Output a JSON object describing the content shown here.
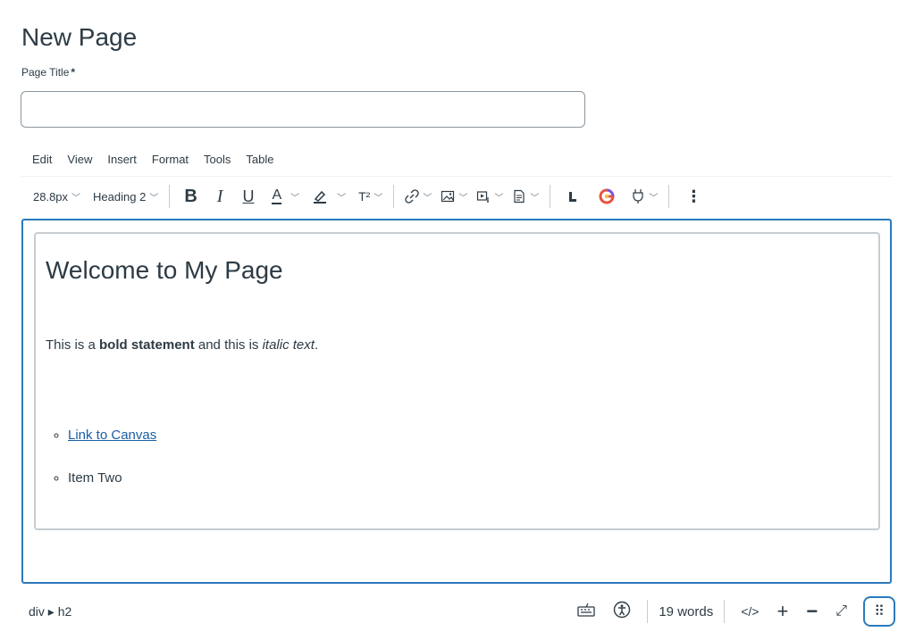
{
  "page": {
    "heading": "New Page",
    "title_label": "Page Title",
    "title_required": "*",
    "title_value": ""
  },
  "menubar": [
    "Edit",
    "View",
    "Insert",
    "Format",
    "Tools",
    "Table"
  ],
  "toolbar": {
    "font_size": "28.8px",
    "block_format": "Heading 2",
    "bold_glyph": "B",
    "italic_glyph": "I",
    "underline_glyph": "U",
    "text_color_glyph": "A",
    "superscript_glyph": "T²",
    "more_glyph": "⋮",
    "icons": [
      "bold-icon",
      "italic-icon",
      "underline-icon",
      "text-color-icon",
      "highlight-icon",
      "superscript-icon",
      "link-icon",
      "image-icon",
      "media-icon",
      "document-icon",
      "lti-icon",
      "apps-icon",
      "plugin-icon",
      "more-icon"
    ]
  },
  "content": {
    "heading": "Welcome to My Page",
    "para_pre": "This is a ",
    "para_bold": "bold statement",
    "para_mid": " and this is ",
    "para_italic": "italic text",
    "para_end": ".",
    "list": [
      "Link to Canvas",
      "Item Two"
    ]
  },
  "status": {
    "path": "div ▸ h2",
    "word_count": "19 words",
    "html_toggle": "</>",
    "zoom_in": "+",
    "zoom_out": "−",
    "fullscreen": "⤢",
    "resize_glyph": "⠿"
  },
  "colors": {
    "accent": "#2b7abc",
    "text": "#2d3b45",
    "link": "#1a5fa5"
  }
}
